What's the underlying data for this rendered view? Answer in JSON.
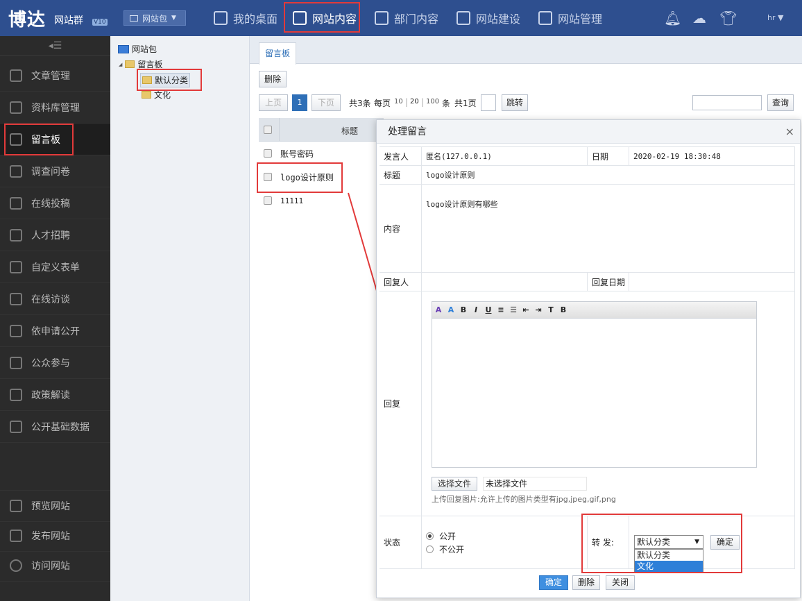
{
  "topbar": {
    "logo": "博达",
    "logo_sub": "网站群",
    "version": "V10",
    "site_select": "网站包",
    "nav": [
      {
        "label": "我的桌面",
        "active": false
      },
      {
        "label": "网站内容",
        "active": true
      },
      {
        "label": "部门内容",
        "active": false
      },
      {
        "label": "网站建设",
        "active": false
      },
      {
        "label": "网站管理",
        "active": false
      }
    ],
    "icons": [
      "bell-icon",
      "cloud-icon",
      "shirt-icon"
    ],
    "user": "hr"
  },
  "sidebar": {
    "collapse_glyph": "◂☰",
    "items": [
      {
        "label": "文章管理",
        "icon": "article-icon",
        "active": false
      },
      {
        "label": "资料库管理",
        "icon": "library-icon",
        "active": false
      },
      {
        "label": "留言板",
        "icon": "message-icon",
        "active": true
      },
      {
        "label": "调查问卷",
        "icon": "survey-icon",
        "active": false
      },
      {
        "label": "在线投稿",
        "icon": "submit-icon",
        "active": false
      },
      {
        "label": "人才招聘",
        "icon": "recruit-icon",
        "active": false
      },
      {
        "label": "自定义表单",
        "icon": "form-icon",
        "active": false
      },
      {
        "label": "在线访谈",
        "icon": "mic-icon",
        "active": false
      },
      {
        "label": "依申请公开",
        "icon": "monitor-icon",
        "active": false
      },
      {
        "label": "公众参与",
        "icon": "people-icon",
        "active": false
      },
      {
        "label": "政策解读",
        "icon": "book-icon",
        "active": false
      },
      {
        "label": "公开基础数据",
        "icon": "chart-icon",
        "active": false
      }
    ],
    "bottom_items": [
      {
        "label": "预览网站",
        "icon": "preview-icon"
      },
      {
        "label": "发布网站",
        "icon": "publish-icon"
      },
      {
        "label": "访问网站",
        "icon": "globe-icon"
      }
    ]
  },
  "tree": {
    "root": "网站包",
    "node": "留言板",
    "children": [
      "默认分类",
      "文化"
    ],
    "expander": "◢"
  },
  "main": {
    "tab": "留言板",
    "delete_label": "删除",
    "pager": {
      "prev": "上页",
      "current": "1",
      "next": "下页",
      "total": "共3条",
      "per_page_label": "每页",
      "sizes": [
        "10",
        "20",
        "100"
      ],
      "unit": "条",
      "pages": "共1页",
      "jump": "跳转"
    },
    "query_label": "查询",
    "column_title": "标题",
    "rows": [
      "账号密码",
      "logo设计原则",
      "11111"
    ]
  },
  "dialog": {
    "title": "处理留言",
    "close_glyph": "×",
    "labels": {
      "poster": "发言人",
      "date": "日期",
      "subject": "标题",
      "content": "内容",
      "replier": "回复人",
      "reply_date": "回复日期",
      "reply": "回复",
      "status": "状态",
      "forward": "转 发:"
    },
    "values": {
      "poster": "匿名(127.0.0.1)",
      "date": "2020-02-19 18:30:48",
      "subject": "logo设计原则",
      "content": "logo设计原则有哪些",
      "replier": "",
      "reply_date": ""
    },
    "toolbar_glyphs": [
      "A",
      "A",
      "B",
      "I",
      "U",
      "≡",
      "☰",
      "⇤",
      "⇥",
      "T",
      "B"
    ],
    "choose_file": "选择文件",
    "no_file": "未选择文件",
    "upload_hint": "上传回复图片:允许上传的图片类型有jpg,jpeg,gif,png",
    "status_options": [
      {
        "label": "公开",
        "checked": true
      },
      {
        "label": "不公开",
        "checked": false
      }
    ],
    "forward_select": "默认分类",
    "forward_options": [
      "默认分类",
      "文化"
    ],
    "forward_highlighted": "文化",
    "forward_ok": "确定",
    "footer": {
      "ok": "确定",
      "delete": "删除",
      "close": "关闭"
    }
  }
}
